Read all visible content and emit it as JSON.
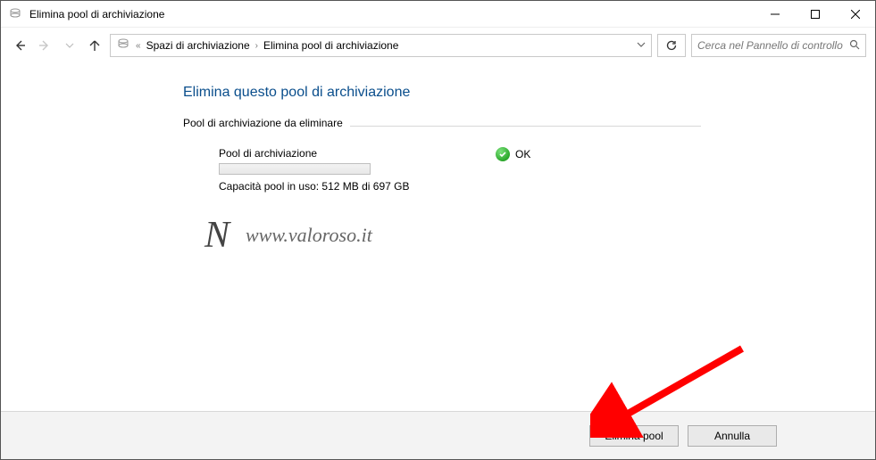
{
  "window": {
    "title": "Elimina pool di archiviazione"
  },
  "breadcrumb": {
    "root": "Spazi di archiviazione",
    "current": "Elimina pool di archiviazione"
  },
  "search": {
    "placeholder": "Cerca nel Pannello di controllo"
  },
  "main": {
    "heading": "Elimina questo pool di archiviazione",
    "group_label": "Pool di archiviazione da eliminare",
    "pool_name": "Pool di archiviazione",
    "capacity_text": "Capacità pool in uso: 512 MB di 697 GB",
    "status_text": "OK"
  },
  "watermark": {
    "logo": "N",
    "text": "www.valoroso.it"
  },
  "footer": {
    "primary": "Elimina pool",
    "secondary": "Annulla"
  }
}
